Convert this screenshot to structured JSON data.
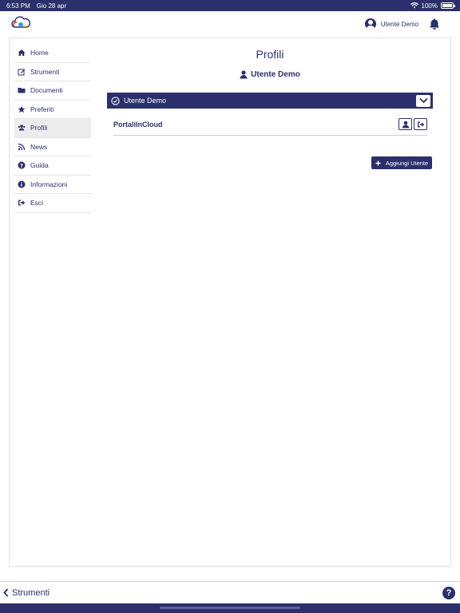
{
  "status_bar": {
    "time": "6:53 PM",
    "date": "Gio 28 apr",
    "battery": "100%"
  },
  "header": {
    "user_name": "Utente Demo"
  },
  "sidebar": {
    "items": [
      {
        "label": "Home",
        "icon": "home-icon"
      },
      {
        "label": "Strumenti",
        "icon": "edit-icon"
      },
      {
        "label": "Documenti",
        "icon": "folder-icon"
      },
      {
        "label": "Preferiti",
        "icon": "star-icon"
      },
      {
        "label": "Profili",
        "icon": "users-icon",
        "active": true
      },
      {
        "label": "News",
        "icon": "rss-icon"
      },
      {
        "label": "Guida",
        "icon": "question-icon"
      },
      {
        "label": "Informazioni",
        "icon": "info-icon"
      },
      {
        "label": "Esci",
        "icon": "sign-out-icon"
      }
    ]
  },
  "main": {
    "title": "Profili",
    "current_user": "Utente Demo",
    "accordion": {
      "header": "Utente Demo",
      "rows": [
        {
          "name": "PortaliInCloud"
        }
      ]
    },
    "add_button": "Aggiungi Utente"
  },
  "bottom_bar": {
    "back_label": "Strumenti",
    "help_label": "?"
  },
  "colors": {
    "primary": "#2b2f6b",
    "background": "#ffffff",
    "active_item": "#ececec"
  }
}
